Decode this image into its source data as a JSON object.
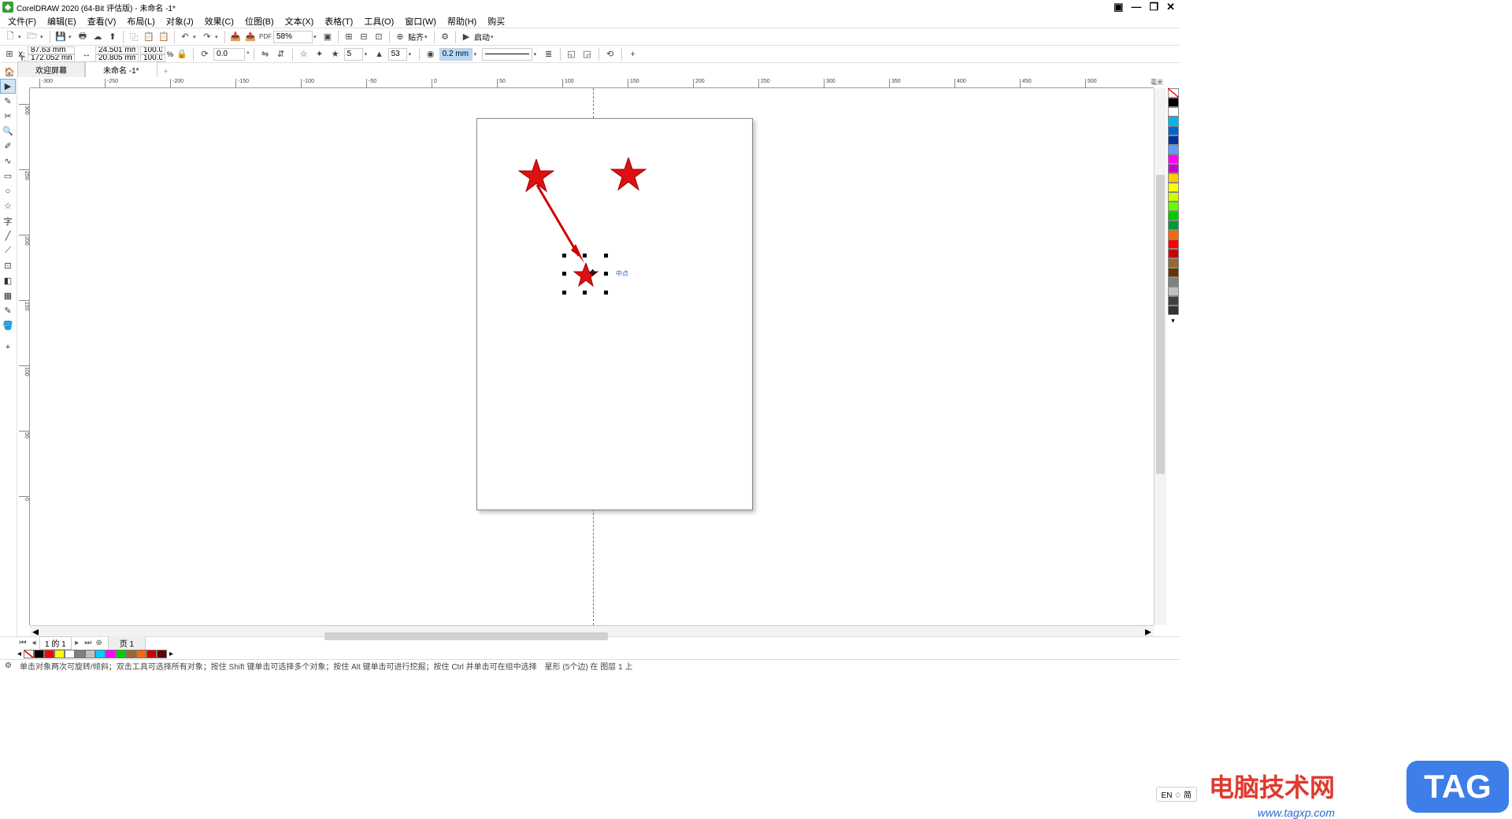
{
  "title": "CorelDRAW 2020 (64-Bit 评估版) - 未命名 -1*",
  "menu": [
    "文件(F)",
    "编辑(E)",
    "查看(V)",
    "布局(L)",
    "对象(J)",
    "效果(C)",
    "位图(B)",
    "文本(X)",
    "表格(T)",
    "工具(O)",
    "窗口(W)",
    "帮助(H)",
    "购买"
  ],
  "toolbar1": {
    "zoom": "58%",
    "align": "贴齐",
    "launch": "启动"
  },
  "toolbar2": {
    "x_label": "X:",
    "y_label": "Y:",
    "x": "87.63 mm",
    "y": "172.052 mm",
    "w": "24.501 mm",
    "h": "20.805 mm",
    "sx": "100.0",
    "sy": "100.0",
    "pct": "%",
    "rotate": "0.0",
    "deg": "°",
    "points": "5",
    "sharp": "53",
    "outline": "0.2 mm"
  },
  "tabs": {
    "welcome": "欢迎屏幕",
    "doc": "未命名 -1*"
  },
  "ruler_unit": "毫米",
  "ruler_h": [
    "-300",
    "-250",
    "-200",
    "-150",
    "-100",
    "-50",
    "0",
    "50",
    "100",
    "150",
    "200",
    "250",
    "300",
    "350",
    "400",
    "450",
    "500"
  ],
  "ruler_v": [
    "300",
    "250",
    "200",
    "150",
    "100",
    "50",
    "0"
  ],
  "guide_label": "中点",
  "pagenav": {
    "counter": "1 的 1",
    "page": "页 1"
  },
  "status": {
    "hint": "单击对象两次可旋转/倾斜；双击工具可选择所有对象；按住 Shift 键单击可选择多个对象；按住 Alt 键单击可进行挖掘；按住 Ctrl 并单击可在组中选择",
    "sel": "星形 (5个边) 在 图层 1 上",
    "lang": "EN ♢ 简"
  },
  "palette": [
    "#000000",
    "#ffffff",
    "#00b7eb",
    "#0066cc",
    "#003399",
    "#6699ff",
    "#ff00ff",
    "#cc00cc",
    "#ffcc00",
    "#ffff00",
    "#ccff00",
    "#66ff00",
    "#00cc00",
    "#009933",
    "#ff6600",
    "#ff0000",
    "#cc0000",
    "#996633",
    "#663300",
    "#808080",
    "#c0c0c0",
    "#404040",
    "#333333"
  ],
  "colortray": [
    "#000000",
    "#ff0000",
    "#ffff00",
    "#ffffff",
    "#808080",
    "#c0c0c0",
    "#00ccff",
    "#ff00ff",
    "#00cc00",
    "#996633",
    "#ff6600",
    "#cc0000",
    "#660000"
  ],
  "watermark1": "电脑技术网",
  "watermark2": "www.tagxp.com",
  "tag": "TAG"
}
